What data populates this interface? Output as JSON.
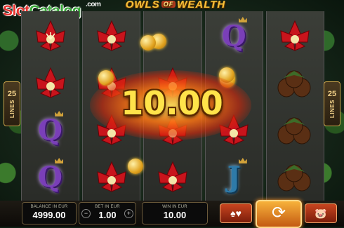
{
  "watermark": {
    "slot": "Slot",
    "catalog": "Catalog",
    "com": ".com"
  },
  "title": {
    "left": "OWLS",
    "of": "OF",
    "right": "WEALTH"
  },
  "lines": {
    "count": "25",
    "label": "LINES"
  },
  "win_overlay": "10.00",
  "reels": [
    [
      "flower",
      "flower",
      "Q",
      "Q"
    ],
    [
      "flower",
      "flower",
      "flower",
      "flower"
    ],
    [
      "coin",
      "flower",
      "flower",
      "flower"
    ],
    [
      "Q",
      "coin",
      "flower",
      "J"
    ],
    [
      "flower",
      "nuts",
      "nuts",
      "nuts"
    ]
  ],
  "panels": {
    "balance": {
      "label": "BALANCE IN EUR",
      "value": "4999.00"
    },
    "bet": {
      "label": "BET IN EUR",
      "value": "1.00",
      "minus": "−",
      "plus": "+"
    },
    "win": {
      "label": "WIN IN EUR",
      "value": "10.00"
    }
  },
  "buttons": {
    "gamble": "♠♥",
    "spin": "⟳",
    "autoplay": "🐷"
  },
  "colors": {
    "accent_gold": "#f5c13b",
    "win_text": "#ffe34a",
    "spin_orange": "#f7b23b"
  }
}
